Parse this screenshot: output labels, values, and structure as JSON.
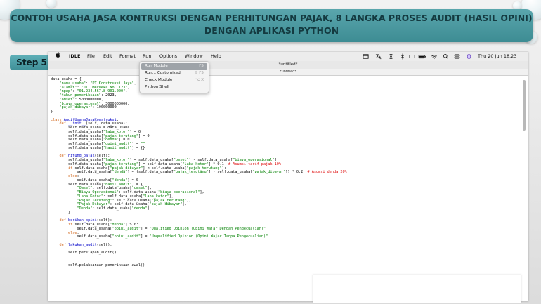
{
  "banner": {
    "line1": "CONTOH USAHA JASA KONTRUKSI DENGAN PERHITUNGAN PAJAK, 8 LANGKA PROSES AUDIT (HASIL OPINI)",
    "line2": "DENGAN APLIKASI PYTHON"
  },
  "step_label": "Step 5",
  "menubar": {
    "apple": "",
    "items": [
      "IDLE",
      "File",
      "Edit",
      "Format",
      "Run",
      "Options",
      "Window",
      "Help"
    ],
    "clock": "Thu 20 Jun  18.23"
  },
  "window": {
    "title": "*untitled*",
    "tab": "*untitled*"
  },
  "run_menu": {
    "items": [
      {
        "label": "Run Module",
        "shortcut": "F5"
      },
      {
        "label": "Run... Customized",
        "shortcut": "⇧ F5"
      },
      {
        "label": "Check Module",
        "shortcut": "⌥ X"
      },
      {
        "label": "Python Shell",
        "shortcut": ""
      }
    ]
  },
  "code_lines": [
    "data_usaha = {",
    "    \"nama_usaha\": \"PT Konstruksi Jaya\",",
    "    \"alamat\": \"Jl. Merdeka No. 123\",",
    "    \"npwp\": \"01.234.567.8-901.000\",",
    "    \"tahun_pemeriksaan\": 2023,",
    "    \"omset\": 5000000000,",
    "    \"biaya_operasional\": 3000000000,",
    "    \"pajak_dibayar\": 100000000",
    "}",
    "",
    "class AuditUsahaJasaKonstruksi:",
    "    def __init__(self, data_usaha):",
    "        self.data_usaha = data_usaha",
    "        self.data_usaha[\"laba_kotor\"] = 0",
    "        self.data_usaha[\"pajak_terutang\"] = 0",
    "        self.data_usaha[\"denda\"] = 0",
    "        self.data_usaha[\"opini_audit\"] = \"\"",
    "        self.data_usaha[\"hasil_audit\"] = {}",
    "",
    "    def hitung_pajak(self):",
    "        self.data_usaha[\"laba_kotor\"] = self.data_usaha[\"omset\"] - self.data_usaha[\"biaya_operasional\"]",
    "        self.data_usaha[\"pajak_terutang\"] = self.data_usaha[\"laba_kotor\"] * 0.1  # Asumsi tarif pajak 10%",
    "        if self.data_usaha[\"pajak_dibayar\"] < self.data_usaha[\"pajak_terutang\"]:",
    "            self.data_usaha[\"denda\"] = (self.data_usaha[\"pajak_terutang\"] - self.data_usaha[\"pajak_dibayar\"]) * 0.2  # Asumsi denda 20%",
    "        else:",
    "            self.data_usaha[\"denda\"] = 0",
    "        self.data_usaha[\"hasil_audit\"] = {",
    "            \"Omset\": self.data_usaha[\"omset\"],",
    "            \"Biaya Operasional\": self.data_usaha[\"biaya_operasional\"],",
    "            \"Laba Kotor\": self.data_usaha[\"laba_kotor\"],",
    "            \"Pajak Terutang\": self.data_usaha[\"pajak_terutang\"],",
    "            \"Pajak Dibayar\": self.data_usaha[\"pajak_dibayar\"],",
    "            \"Denda\": self.data_usaha[\"denda\"]",
    "        }",
    "",
    "    def berikan_opini(self):",
    "        if self.data_usaha[\"denda\"] > 0:",
    "            self.data_usaha[\"opini_audit\"] = \"Qualified Opinion (Opini Wajar Dengan Pengecualian)\"",
    "        else:",
    "            self.data_usaha[\"opini_audit\"] = \"Unqualified Opinion (Opini Wajar Tanpa Pengecualian)\"",
    "",
    "    def lakukan_audit(self):",
    "",
    "        self.persiapan_audit()",
    "",
    "",
    "        self.pelaksanaan_pemeriksaan_awal()"
  ]
}
